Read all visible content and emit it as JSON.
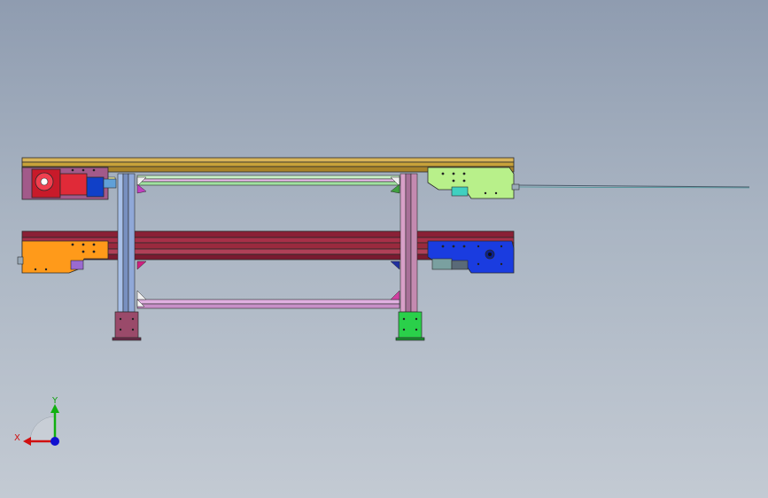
{
  "view": {
    "triad": {
      "x_label": "X",
      "y_label": "Y"
    }
  },
  "colors": {
    "background_top": "#8f9cb0",
    "background_bottom": "#c3cad3",
    "top_rail": "#c8a23a",
    "lower_rail": "#9a2a3e",
    "drive_motor": "#d4202a",
    "drive_bracket": "#a25a8a",
    "blue_gearbox": "#1040c8",
    "light_green_plate": "#b8f08a",
    "orange_plate": "#ff9a1a",
    "blue_plate": "#1a3ce0",
    "leg_left": "#8aa8d8",
    "leg_right": "#c48ab0",
    "foot_left": "#9a4a6a",
    "foot_right": "#2ad04a",
    "crossbar": "#d8a8d8",
    "axis_x": "#d01010",
    "axis_y": "#10b010",
    "axis_z": "#1010d0"
  }
}
